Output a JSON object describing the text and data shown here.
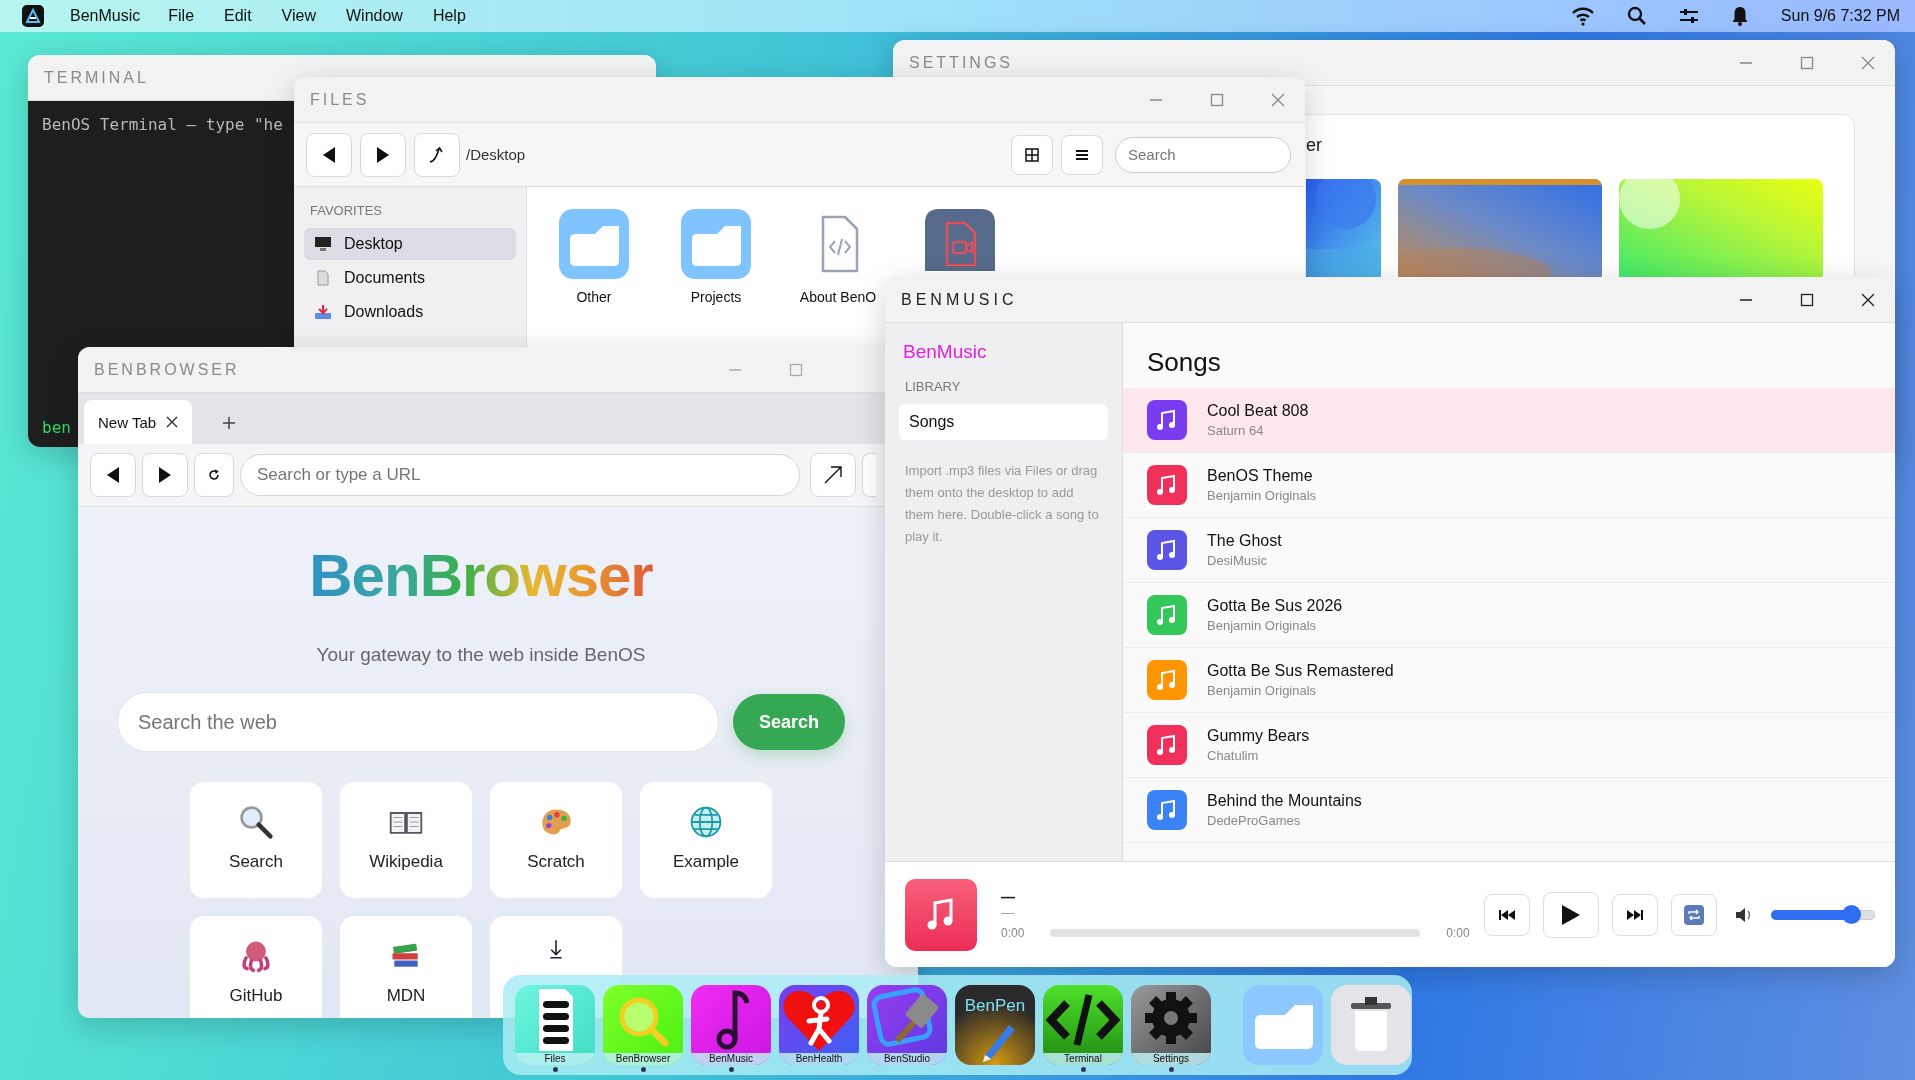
{
  "menu_bar": {
    "app_name": "BenMusic",
    "menus": [
      "File",
      "Edit",
      "View",
      "Window",
      "Help"
    ],
    "clock": "Sun 9/6 7:32 PM"
  },
  "terminal": {
    "title": "TERMINAL",
    "intro": "BenOS Terminal — type \"he",
    "prompt": "ben"
  },
  "settings": {
    "title": "SETTINGS",
    "section_title": "er"
  },
  "files": {
    "title": "FILES",
    "path": "/Desktop",
    "search": {
      "placeholder": "Search"
    },
    "sidebar": {
      "heading": "FAVORITES",
      "items": [
        {
          "label": "Desktop",
          "selected": true
        },
        {
          "label": "Documents",
          "selected": false
        },
        {
          "label": "Downloads",
          "selected": false
        }
      ]
    },
    "items": [
      {
        "kind": "folder",
        "label": "Other"
      },
      {
        "kind": "folder",
        "label": "Projects"
      },
      {
        "kind": "code",
        "label": "About BenO"
      },
      {
        "kind": "video"
      }
    ]
  },
  "browser": {
    "title": "BENBROWSER",
    "tabs": [
      {
        "label": "New Tab",
        "selected": true
      }
    ],
    "url": {
      "placeholder": "Search or type a URL"
    },
    "logo": "BenBrowser",
    "tagline": "Your gateway to the web inside BenOS",
    "search": {
      "placeholder": "Search the web",
      "button": "Search"
    },
    "shortcuts": [
      {
        "kind": "link",
        "label": "Search"
      },
      {
        "kind": "link",
        "label": "Wikipedia"
      },
      {
        "kind": "link",
        "label": "Scratch"
      },
      {
        "kind": "link",
        "label": "Example"
      },
      {
        "kind": "link",
        "label": "GitHub"
      },
      {
        "kind": "link",
        "label": "MDN"
      },
      {
        "kind": "download"
      }
    ]
  },
  "music": {
    "title": "BENMUSIC",
    "brand": "BenMusic",
    "library_heading": "LIBRARY",
    "nav": [
      {
        "label": "Songs",
        "selected": true
      }
    ],
    "hint": "Import .mp3 files via Files or drag them onto the desktop to add them here. Double-click a song to play it.",
    "heading": "Songs",
    "songs": [
      {
        "title": "Cool Beat 808",
        "artist": "Saturn 64",
        "color": "#7a3cf0",
        "selected": true
      },
      {
        "title": "BenOS Theme",
        "artist": "Benjamin Originals",
        "color": "#f0305a",
        "selected": false
      },
      {
        "title": "The Ghost",
        "artist": "DesiMusic",
        "color": "#5b55e6",
        "selected": false
      },
      {
        "title": "Gotta Be Sus 2026",
        "artist": "Benjamin Originals",
        "color": "#34c759",
        "selected": false
      },
      {
        "title": "Gotta Be Sus Remastered",
        "artist": "Benjamin Originals",
        "color": "#ff9500",
        "selected": false
      },
      {
        "title": "Gummy Bears",
        "artist": "Chatulim",
        "color": "#f0305a",
        "selected": false
      },
      {
        "title": "Behind the Mountains",
        "artist": "DedeProGames",
        "color": "#3b82f6",
        "selected": false
      }
    ],
    "player": {
      "title": "—",
      "artist": "—",
      "elapsed": "0:00",
      "duration": "0:00",
      "progress": {
        "level": 0
      },
      "volume": {
        "level": 0.77
      }
    }
  },
  "dock": {
    "apps": [
      {
        "label": "Files",
        "running": true
      },
      {
        "label": "BenBrowser",
        "running": true
      },
      {
        "label": "BenMusic",
        "running": true
      },
      {
        "label": "BenHealth",
        "running": false
      },
      {
        "label": "BenStudio",
        "running": false
      },
      {
        "icon_text": "BenPen",
        "running": false
      },
      {
        "label": "Terminal",
        "running": true
      },
      {
        "label": "Settings",
        "running": true
      }
    ]
  }
}
